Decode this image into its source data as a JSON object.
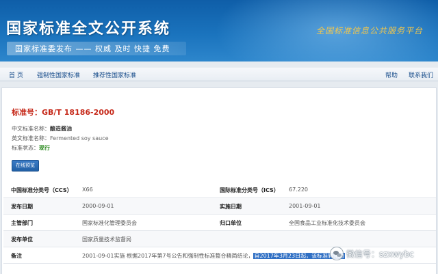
{
  "header": {
    "title": "国家标准全文公开系统",
    "subtitle": "国家标准委发布 —— 权威 及时 快捷 免费",
    "slogan": "全国标准信息公共服务平台"
  },
  "nav": {
    "items": [
      "首 页",
      "强制性国家标准",
      "推荐性国家标准"
    ],
    "help": "帮助",
    "contact": "联系我们"
  },
  "standard": {
    "number_label": "标准号：",
    "number": "GB/T 18186-2000",
    "cn_name_label": "中文标准名称：",
    "cn_name": "酿造酱油",
    "en_name_label": "英文标准名称：",
    "en_name": "Fermented soy sauce",
    "status_label": "标准状态：",
    "status": "现行",
    "online_button": "在线预览"
  },
  "table": {
    "ccs_label": "中国标准分类号（CCS）",
    "ccs": "X66",
    "ics_label": "国际标准分类号（ICS）",
    "ics": "67.220",
    "publish_date_label": "发布日期",
    "publish_date": "2000-09-01",
    "implement_date_label": "实施日期",
    "implement_date": "2001-09-01",
    "dept_label": "主管部门",
    "dept": "国家标准化管理委员会",
    "owner_label": "归口单位",
    "owner": "全国食品工业标准化技术委员会",
    "publisher_label": "发布单位",
    "publisher": "国家质量技术监督局",
    "remark_label": "备注",
    "remark_plain": "2001-09-01实施 根据2017年第7号公告和强制性标准整合精简结论，",
    "remark_highlight": "自2017年3月23日起，该标准转化为"
  },
  "watermark": {
    "text": "微信号：szxwybc"
  },
  "colors": {
    "banner": "#1a73bd",
    "slogan": "#f4c74a",
    "std_number": "#c62a1b",
    "status": "#2b8a1f",
    "link": "#1b4f8c",
    "highlight": "#2f6fc4"
  }
}
